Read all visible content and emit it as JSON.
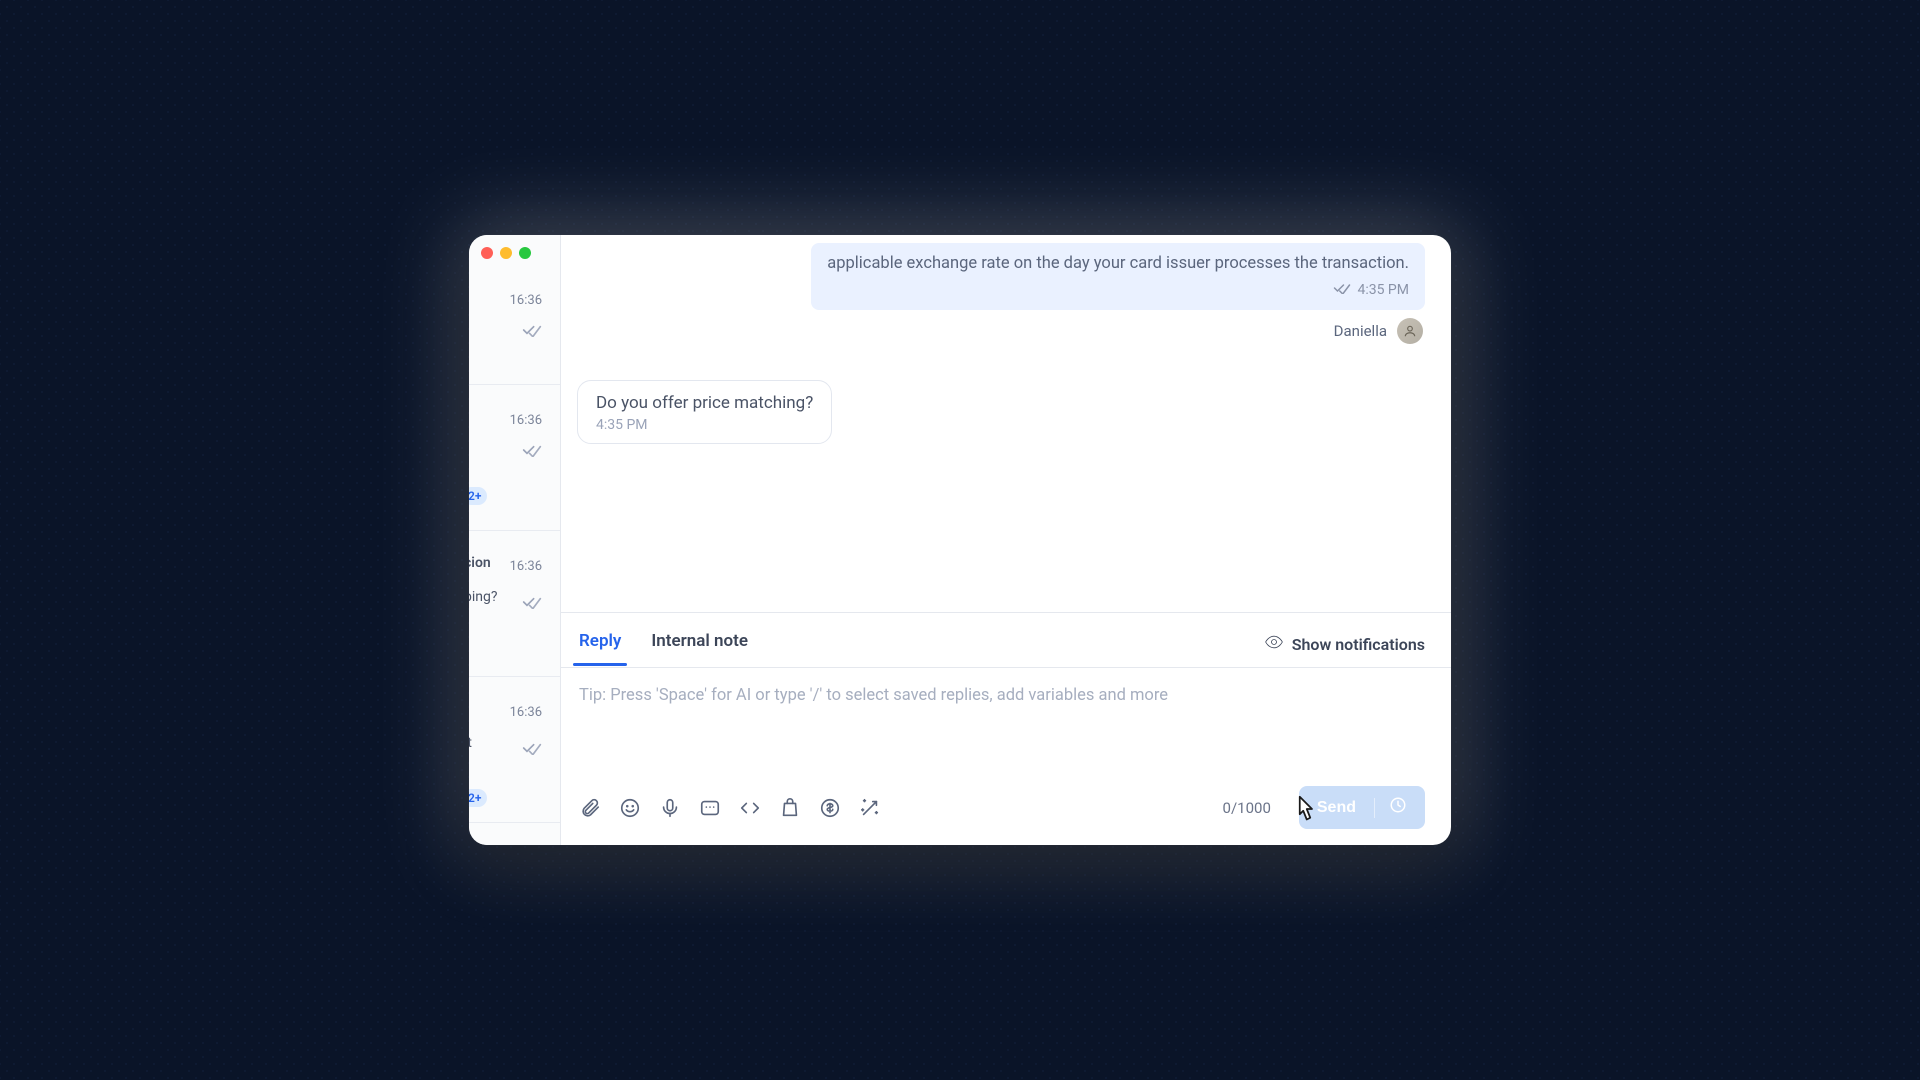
{
  "sidebar": {
    "items": [
      {
        "time": "16:36",
        "fragment": "",
        "badge": ""
      },
      {
        "time": "16:36",
        "fragment": "",
        "badge": "2+"
      },
      {
        "time": "16:36",
        "fragment_title": "cion",
        "fragment": "ping?",
        "badge": ""
      },
      {
        "time": "16:36",
        "fragment": "it",
        "badge": "2+"
      }
    ]
  },
  "chat": {
    "agent_bubble_text": "applicable exchange rate on the day your card issuer processes the transaction.",
    "agent_bubble_time": "4:35 PM",
    "agent_name": "Daniella",
    "customer_text": "Do you offer price matching?",
    "customer_time": "4:35 PM"
  },
  "composer": {
    "tabs": {
      "reply": "Reply",
      "internal": "Internal note"
    },
    "show_notifications": "Show notifications",
    "placeholder": "Tip: Press 'Space' for AI or type '/' to select saved replies, add variables and more",
    "counter": "0/1000",
    "send_label": "Send"
  }
}
